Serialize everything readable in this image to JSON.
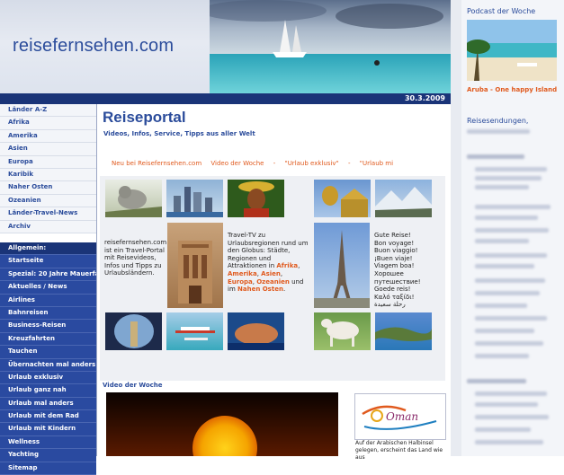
{
  "header": {
    "logo_text": "reisefernsehen.com",
    "date": "30.3.2009"
  },
  "nav_countries": [
    {
      "label": "Länder A-Z"
    },
    {
      "label": "Afrika"
    },
    {
      "label": "Amerika"
    },
    {
      "label": "Asien"
    },
    {
      "label": "Europa"
    },
    {
      "label": "Karibik"
    },
    {
      "label": "Naher Osten"
    },
    {
      "label": "Ozeanien"
    },
    {
      "label": "Länder-Travel-News"
    },
    {
      "label": "Archiv"
    }
  ],
  "nav_general": [
    {
      "label": "Allgemein:"
    },
    {
      "label": "Startseite"
    },
    {
      "label": "Spezial: 20 Jahre Mauerfall"
    },
    {
      "label": "Aktuelles / News"
    },
    {
      "label": "Airlines"
    },
    {
      "label": "Bahnreisen"
    },
    {
      "label": "Business-Reisen"
    },
    {
      "label": "Kreuzfahrten"
    },
    {
      "label": "Tauchen"
    },
    {
      "label": "Übernachten mal anders"
    },
    {
      "label": "Urlaub exklusiv"
    },
    {
      "label": "Urlaub ganz nah"
    },
    {
      "label": "Urlaub mal anders"
    },
    {
      "label": "Urlaub mit dem Rad"
    },
    {
      "label": "Urlaub mit Kindern"
    },
    {
      "label": "Wellness"
    },
    {
      "label": "Yachting"
    },
    {
      "label": "Sitemap"
    }
  ],
  "main": {
    "title": "Reiseportal",
    "subtitle": "Videos, Infos, Service, Tipps aus aller Welt",
    "newsline": [
      "Neu bei Reisefernsehen.com",
      "Video der Woche",
      "-",
      "\"Urlaub exklusiv\"",
      "-",
      "\"Urlaub mi"
    ],
    "intro_left": "reisefernsehen.com ist ein Travel-Portal mit Reisevideos, Infos und Tipps zu Urlaubsländern.",
    "intro_mid_prefix": "Travel-TV zu Urlaubsregionen rund um den Globus: Städte, Regionen und Attraktionen in",
    "regions": {
      "afrika": "Afrika",
      "amerika": "Amerika",
      "asien": "Asien",
      "europa": "Europa",
      "ozeanien": "Ozeanien",
      "nahen_osten": "Nahen Osten"
    },
    "word_und": "und",
    "word_im": "im",
    "greetings": [
      "Gute Reise!",
      "Bon voyage!",
      "Buon viaggio!",
      "¡Buen viaje!",
      "Viagem boa!",
      "Хорошее",
      "путешествие!",
      "Goede reis!",
      "Καλό ταξίδι!",
      "رحلة سعيدة"
    ],
    "video_heading": "Video der Woche",
    "oman_logo": "Oman",
    "oman_caption": "Auf der Arabischen Halbinsel gelegen, erscheint das Land wie aus"
  },
  "right": {
    "podcast_title": "Podcast der Woche",
    "podcast_caption": "Aruba - One happy Island",
    "reisesendungen_title": "Reisesendungen,"
  },
  "colors": {
    "brand_blue": "#2b4c9b",
    "nav_dark": "#1a3478",
    "accent_orange": "#e05a1e"
  }
}
